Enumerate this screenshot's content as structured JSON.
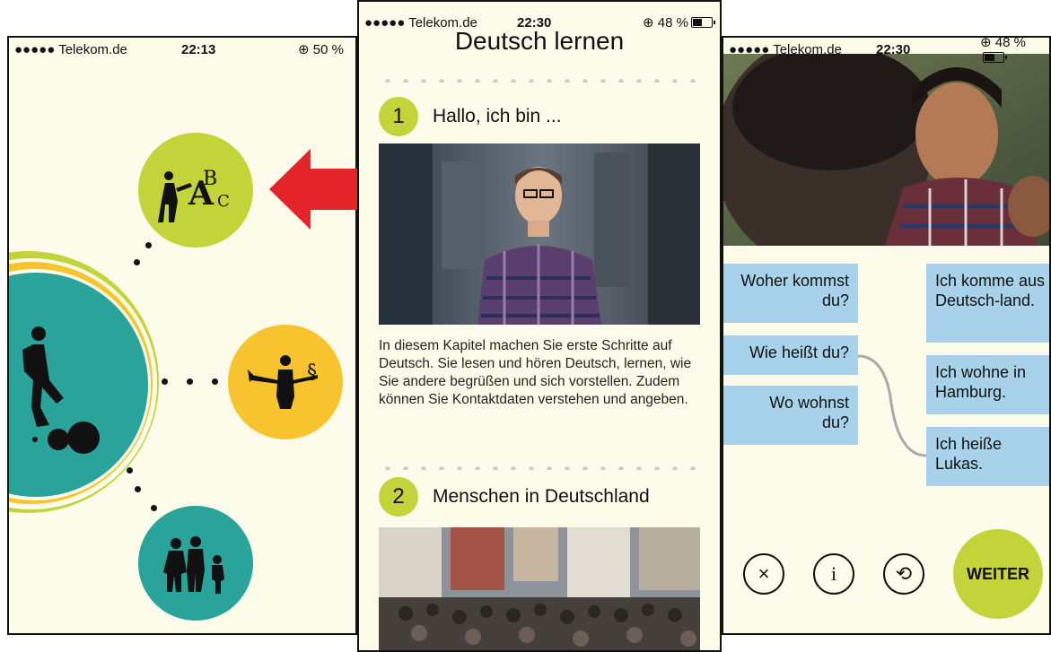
{
  "colors": {
    "cream": "#fdfbea",
    "lime": "#c3d33a",
    "teal": "#2aa39a",
    "yellow": "#f7c42f",
    "red": "#e3242b",
    "card_blue": "#a8d2ea",
    "connector_gray": "#a9a9a9"
  },
  "phone1": {
    "status": {
      "carrier": "●●●●● Telekom.de",
      "time": "22:13",
      "battery": "⊕ 50 %"
    },
    "nodes": [
      {
        "icon": "alphabet-teacher-icon",
        "color": "lime"
      },
      {
        "icon": "athlete-ball-icon",
        "color": "teal"
      },
      {
        "icon": "tools-law-icon",
        "color": "yellow"
      },
      {
        "icon": "family-icon",
        "color": "teal"
      }
    ]
  },
  "phone2": {
    "status": {
      "carrier": "●●●●● Telekom.de",
      "time": "22:30",
      "battery": "⊕ 48 %"
    },
    "title": "Deutsch lernen",
    "chapters": [
      {
        "number": "1",
        "title": "Hallo, ich bin ...",
        "image": "man-in-plaid-shirt-photo",
        "description": "In diesem Kapitel machen Sie erste Schritte auf Deutsch. Sie lesen und hören Deutsch, lernen, wie Sie andere begrüßen und sich vorstellen. Zudem können Sie Kontaktdaten verstehen und angeben."
      },
      {
        "number": "2",
        "title": "Menschen in Deutschland",
        "image": "crowd-street-photo"
      }
    ]
  },
  "phone3": {
    "status": {
      "carrier": "●●●●● Telekom.de",
      "time": "22:30",
      "battery": "⊕ 48 %"
    },
    "image": "two-men-talking-photo",
    "questions": [
      "Woher kommst du?",
      "Wie heißt du?",
      "Wo wohnst du?"
    ],
    "answers": [
      "Ich komme aus Deutsch-land.",
      "Ich wohne in Hamburg.",
      "Ich heiße Lukas."
    ],
    "buttons": {
      "close": "×",
      "info": "i",
      "reset": "⟲",
      "next": "WEITER"
    }
  }
}
